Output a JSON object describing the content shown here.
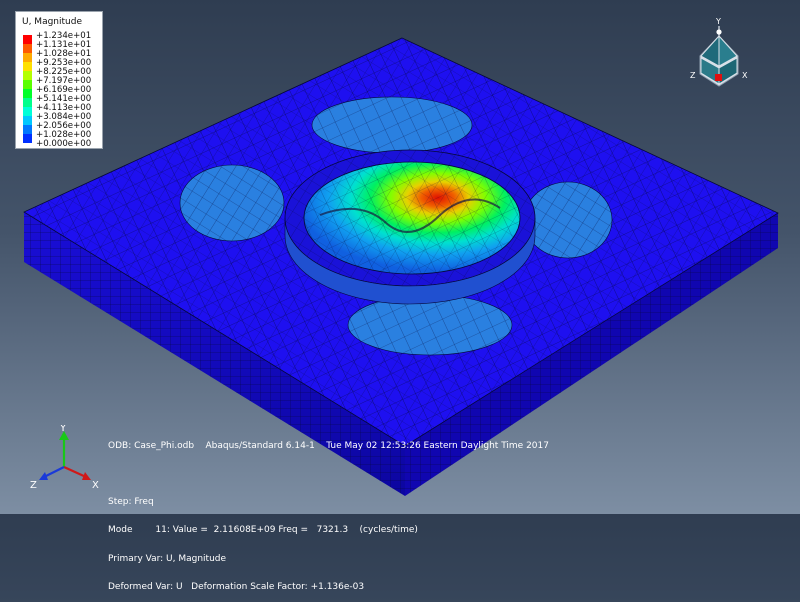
{
  "legend": {
    "title": "U, Magnitude",
    "entries": [
      {
        "value": "+1.234e+01",
        "color": "#ff0000"
      },
      {
        "value": "+1.131e+01",
        "color": "#ff5a00"
      },
      {
        "value": "+1.028e+01",
        "color": "#ffaa00"
      },
      {
        "value": "+9.253e+00",
        "color": "#ffe000"
      },
      {
        "value": "+8.225e+00",
        "color": "#b4ff00"
      },
      {
        "value": "+7.197e+00",
        "color": "#5aff00"
      },
      {
        "value": "+6.169e+00",
        "color": "#00ff2a"
      },
      {
        "value": "+5.141e+00",
        "color": "#00ff8c"
      },
      {
        "value": "+4.113e+00",
        "color": "#00ffd8"
      },
      {
        "value": "+3.084e+00",
        "color": "#00c8ff"
      },
      {
        "value": "+2.056e+00",
        "color": "#0078ff"
      },
      {
        "value": "+1.028e+00",
        "color": "#0030ff"
      },
      {
        "value": "+0.000e+00",
        "color": "#0000ff"
      }
    ]
  },
  "info": {
    "odb_line": "ODB: Case_Phi.odb    Abaqus/Standard 6.14-1    Tue May 02 12:53:26 Eastern Daylight Time 2017",
    "step_line": "Step: Freq",
    "mode_line": "Mode        11: Value =  2.11608E+09 Freq =   7321.3    (cycles/time)",
    "primary_line": "Primary Var: U, Magnitude",
    "deformed_line": "Deformed Var: U   Deformation Scale Factor: +1.136e-03"
  },
  "triad": {
    "x_label": "X",
    "y_label": "Y",
    "z_label": "Z"
  },
  "colors": {
    "plate_top": "#1e10f0",
    "plate_side": "#1208c0",
    "plate_front": "#0d06a8",
    "region_light": "#2a7ee0",
    "mesh_line": "#050a40"
  }
}
